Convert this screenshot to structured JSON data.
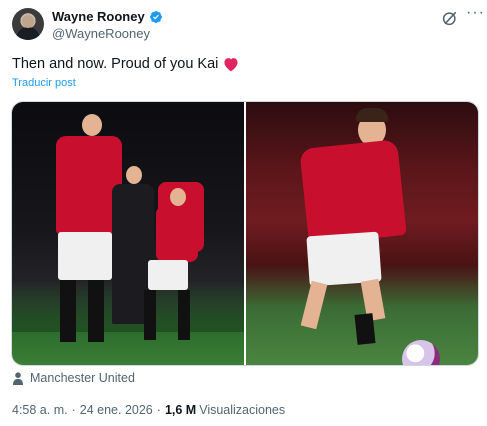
{
  "author": {
    "display_name": "Wayne Rooney",
    "handle": "@WayneRooney",
    "verified": true
  },
  "tweet": {
    "text": "Then and now. Proud of you Kai",
    "emoji": "red-heart",
    "translate_label": "Traducir post"
  },
  "location": "Manchester United",
  "meta": {
    "time": "4:58 a. m.",
    "separator": "·",
    "date": "24 ene. 2026",
    "views_count": "1,6 M",
    "views_label": "Visualizaciones"
  },
  "icons": {
    "verified": "verified-badge-icon",
    "grok": "grok-icon",
    "more": "more-icon",
    "location": "person-location-icon",
    "heart": "red-heart-icon"
  },
  "colors": {
    "accent": "#1d9bf0",
    "secondary_text": "#536471",
    "primary_text": "#0f1419",
    "heart": "#f91880"
  }
}
